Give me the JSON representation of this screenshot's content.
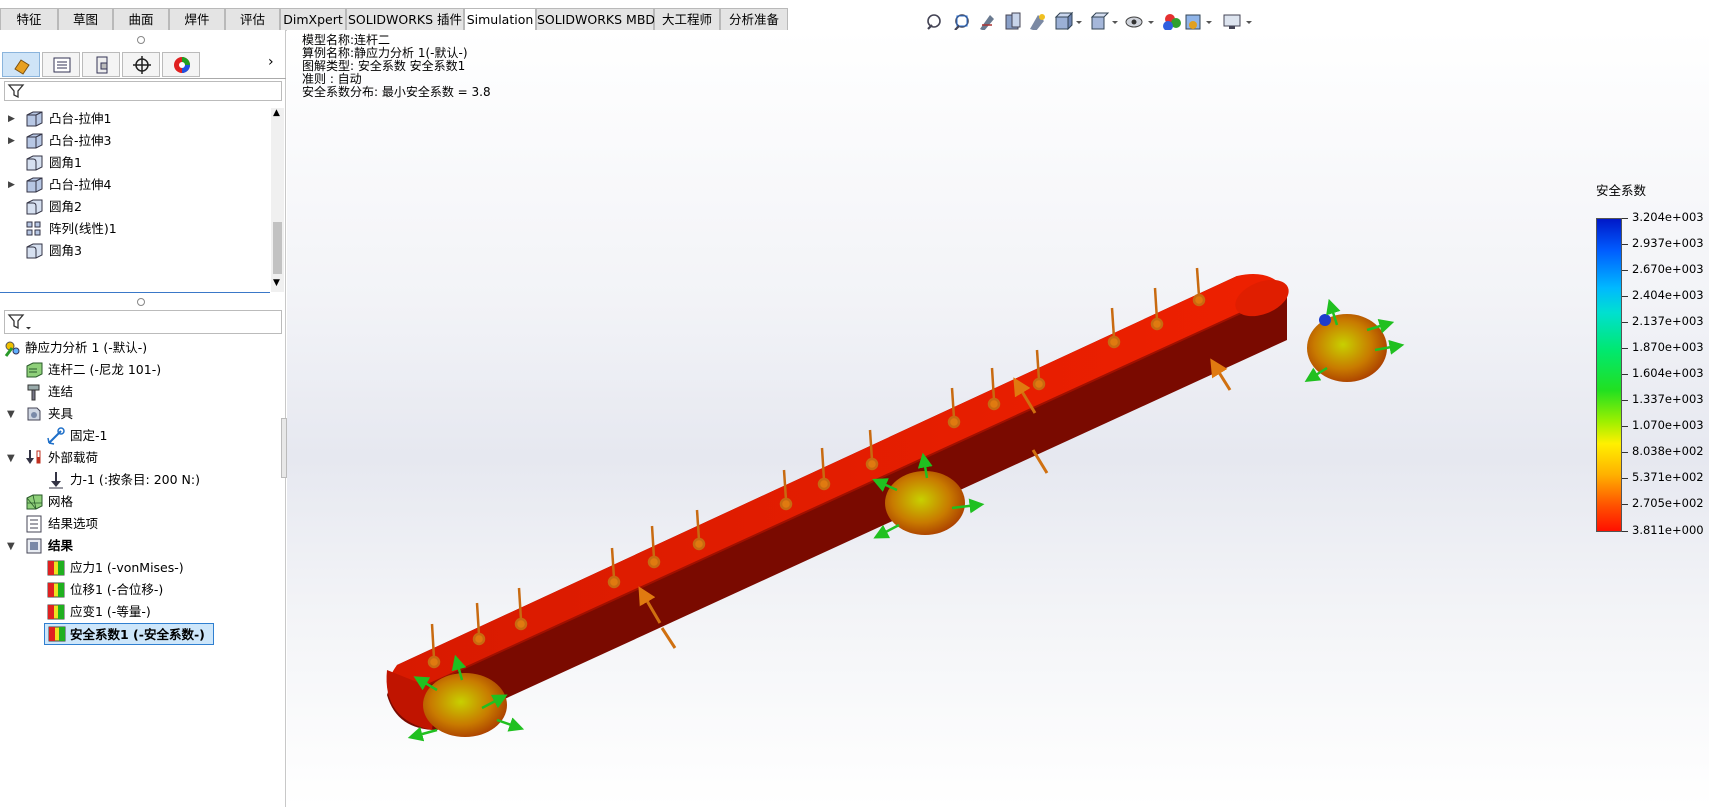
{
  "tabs": [
    {
      "label": "特征",
      "active": false
    },
    {
      "label": "草图",
      "active": false
    },
    {
      "label": "曲面",
      "active": false
    },
    {
      "label": "焊件",
      "active": false
    },
    {
      "label": "评估",
      "active": false
    },
    {
      "label": "DimXpert",
      "active": false
    },
    {
      "label": "SOLIDWORKS 插件",
      "active": false
    },
    {
      "label": "Simulation",
      "active": true
    },
    {
      "label": "SOLIDWORKS MBD",
      "active": false
    },
    {
      "label": "大工程师",
      "active": false
    },
    {
      "label": "分析准备",
      "active": false
    }
  ],
  "feature_tree": {
    "items": [
      {
        "label": "凸台-拉伸1",
        "icon": "boss-extrude-icon",
        "expandable": true
      },
      {
        "label": "凸台-拉伸3",
        "icon": "boss-extrude-icon",
        "expandable": true
      },
      {
        "label": "圆角1",
        "icon": "fillet-icon",
        "expandable": false
      },
      {
        "label": "凸台-拉伸4",
        "icon": "boss-extrude-icon",
        "expandable": true
      },
      {
        "label": "圆角2",
        "icon": "fillet-icon",
        "expandable": false
      },
      {
        "label": "阵列(线性)1",
        "icon": "linear-pattern-icon",
        "expandable": false
      },
      {
        "label": "圆角3",
        "icon": "fillet-icon",
        "expandable": false
      }
    ]
  },
  "study_tree": {
    "items": [
      {
        "label": "静应力分析 1 (-默认-)",
        "icon": "static-study-icon",
        "indent": 0,
        "expander": ""
      },
      {
        "label": "连杆二 (-尼龙 101-)",
        "icon": "part-material-icon",
        "indent": 1,
        "expander": ""
      },
      {
        "label": "连结",
        "icon": "connections-icon",
        "indent": 1,
        "expander": ""
      },
      {
        "label": "夹具",
        "icon": "fixtures-icon",
        "indent": 1,
        "expander": "open"
      },
      {
        "label": "固定-1",
        "icon": "fixed-geometry-icon",
        "indent": 2,
        "expander": ""
      },
      {
        "label": "外部载荷",
        "icon": "external-loads-icon",
        "indent": 1,
        "expander": "open"
      },
      {
        "label": "力-1 (:按条目: 200 N:)",
        "icon": "force-icon",
        "indent": 2,
        "expander": ""
      },
      {
        "label": "网格",
        "icon": "mesh-icon",
        "indent": 1,
        "expander": ""
      },
      {
        "label": "结果选项",
        "icon": "result-options-icon",
        "indent": 1,
        "expander": ""
      },
      {
        "label": "结果",
        "icon": "results-folder-icon",
        "indent": 1,
        "expander": "open",
        "bold": true
      },
      {
        "label": "应力1 (-vonMises-)",
        "icon": "result-plot-icon",
        "indent": 2,
        "expander": ""
      },
      {
        "label": "位移1 (-合位移-)",
        "icon": "result-plot-icon",
        "indent": 2,
        "expander": ""
      },
      {
        "label": "应变1 (-等量-)",
        "icon": "result-plot-icon",
        "indent": 2,
        "expander": ""
      },
      {
        "label": "安全系数1 (-安全系数-)",
        "icon": "result-plot-icon",
        "indent": 2,
        "expander": "",
        "selected": true,
        "bold": true
      }
    ]
  },
  "plot_info": {
    "line1": "模型名称:连杆二",
    "line2": "算例名称:静应力分析 1(-默认-)",
    "line3": "图解类型: 安全系数 安全系数1",
    "line4": "准则 : 自动",
    "line5": "安全系数分布: 最小安全系数 = 3.8"
  },
  "legend": {
    "title": "安全系数",
    "ticks": [
      "3.204e+003",
      "2.937e+003",
      "2.670e+003",
      "2.404e+003",
      "2.137e+003",
      "1.870e+003",
      "1.604e+003",
      "1.337e+003",
      "1.070e+003",
      "8.038e+002",
      "5.371e+002",
      "2.705e+002",
      "3.811e+000"
    ]
  },
  "colors": {
    "part_red": "#e01800",
    "part_dark": "#7a0a00",
    "arrow_orange": "#e07a10",
    "arrow_green": "#20c020",
    "selected_bg": "#cde6fa",
    "selected_border": "#2f7fd0"
  }
}
